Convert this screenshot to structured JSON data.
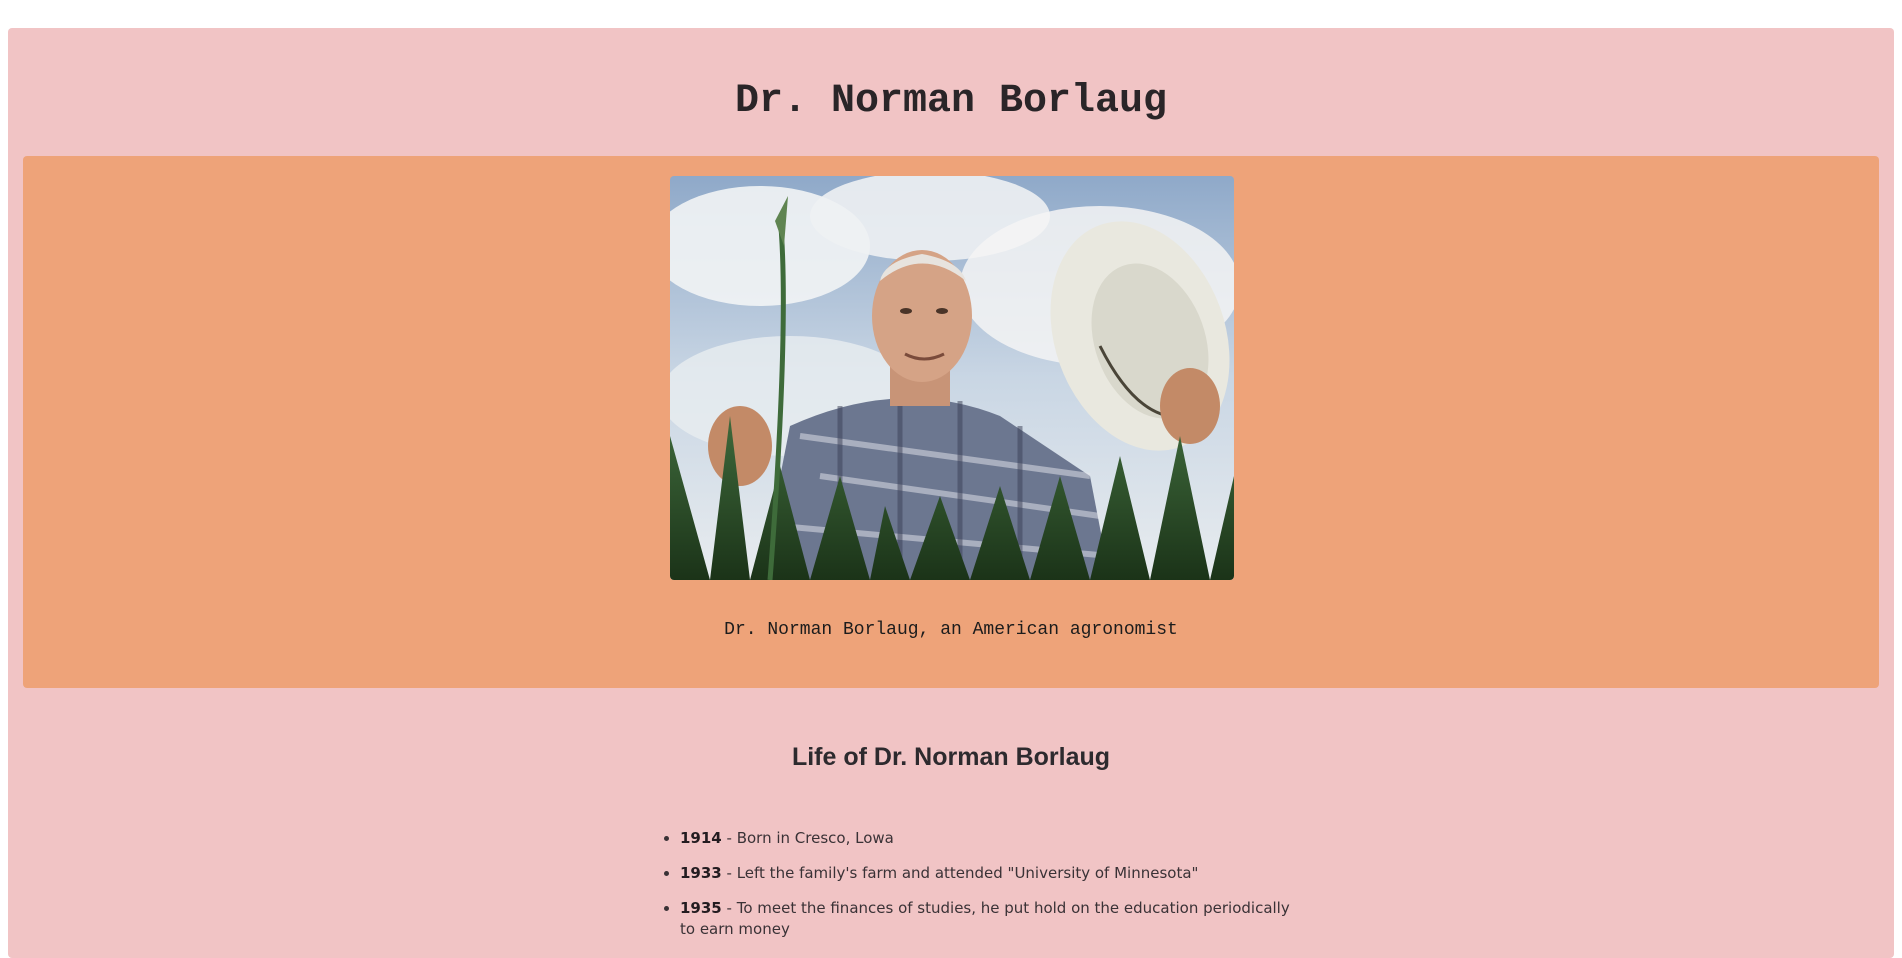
{
  "header": {
    "title": "Dr. Norman Borlaug"
  },
  "figure": {
    "image_description_icon": "portrait-photo",
    "caption": "Dr. Norman Borlaug, an American agronomist"
  },
  "life": {
    "heading": "Life of Dr. Norman Borlaug",
    "items": [
      {
        "year": "1914",
        "text": " - Born in Cresco, Lowa"
      },
      {
        "year": "1933",
        "text": " - Left the family's farm and attended \"University of Minnesota\""
      },
      {
        "year": "1935",
        "text": " - To meet the finances of studies, he put hold on the education periodically to earn money"
      }
    ]
  },
  "colors": {
    "page_bg": "#f1c4c5",
    "image_panel_bg": "#eea379",
    "text": "#2a2528"
  }
}
